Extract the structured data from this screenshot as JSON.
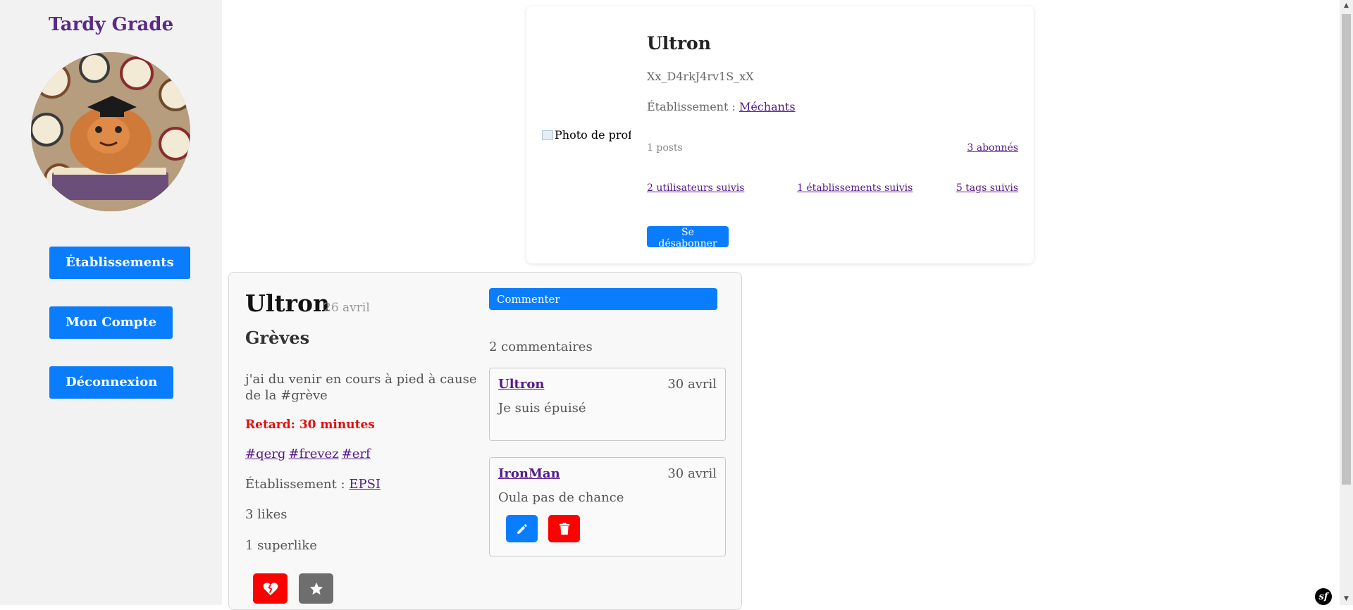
{
  "sidebar": {
    "brand": "Tardy Grade",
    "nav": [
      "Établissements",
      "Mon Compte",
      "Déconnexion"
    ]
  },
  "profile": {
    "photo_alt": "Photo de profil",
    "name": "Ultron",
    "handle": "Xx_D4rkJ4rv1S_xX",
    "etab_label": "Établissement : ",
    "etab_link": "Méchants",
    "posts": "1 posts",
    "followers": "3 abonnés",
    "users_followed": "2 utilisateurs suivis",
    "etabs_followed": "1 établissements suivis",
    "tags_followed": "5 tags suivis",
    "unsubscribe": "Se désabonner"
  },
  "post": {
    "author": "Ultron",
    "date": "26 avril",
    "title": "Grèves",
    "text": "j'ai du venir en cours à pied à cause de la #grève",
    "delay": "Retard: 30 minutes",
    "tags": [
      "#qerg",
      "#frevez",
      "#erf"
    ],
    "etab_label": "Établissement : ",
    "etab_link": "EPSI",
    "likes": "3 likes",
    "superlikes": "1 superlike",
    "comment_button": "Commenter",
    "comment_count": "2 commentaires",
    "comments": [
      {
        "author": "Ultron",
        "date": "30 avril",
        "text": "Je suis épuisé"
      },
      {
        "author": "IronMan",
        "date": "30 avril",
        "text": "Oula pas de chance"
      }
    ]
  },
  "colors": {
    "primary": "#0a7dff",
    "danger": "#ff0000",
    "brand": "#5b2a86",
    "muted_button": "#6e6e6e"
  },
  "icons": {
    "unlike": "heart-broken-icon",
    "superlike": "star-icon",
    "edit": "pencil-icon",
    "delete": "trash-icon",
    "framework": "symfony-icon"
  },
  "footer": {
    "framework_badge": "sf"
  }
}
